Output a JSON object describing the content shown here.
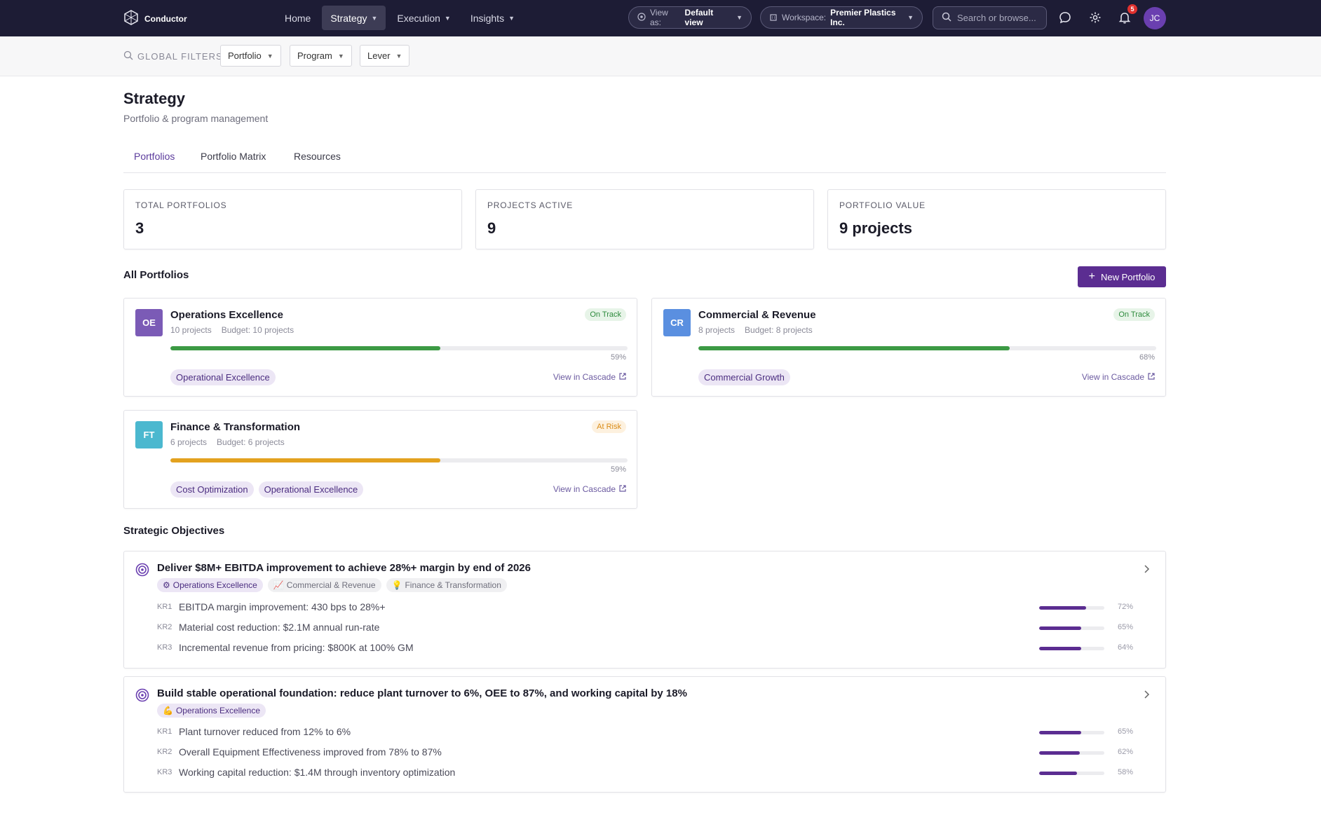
{
  "app": {
    "name": "Conductor"
  },
  "nav": {
    "items": [
      {
        "label": "Home"
      },
      {
        "label": "Strategy"
      },
      {
        "label": "Execution"
      },
      {
        "label": "Insights"
      }
    ],
    "view_as": {
      "label": "View as:",
      "value": "Default view"
    },
    "workspace": {
      "label": "Workspace:",
      "value": "Premier Plastics Inc."
    },
    "search_placeholder": "Search or browse...",
    "notifications_count": "5",
    "user_initials": "JC"
  },
  "filters": {
    "label": "GLOBAL FILTERS",
    "buttons": [
      {
        "label": "Portfolio"
      },
      {
        "label": "Program"
      },
      {
        "label": "Lever"
      }
    ]
  },
  "page": {
    "title": "Strategy",
    "subtitle": "Portfolio & program management",
    "tabs": [
      {
        "label": "Portfolios"
      },
      {
        "label": "Portfolio Matrix"
      },
      {
        "label": "Resources"
      }
    ]
  },
  "stats": [
    {
      "label": "TOTAL PORTFOLIOS",
      "value": "3"
    },
    {
      "label": "PROJECTS ACTIVE",
      "value": "9"
    },
    {
      "label": "PORTFOLIO VALUE",
      "value": "9 projects"
    }
  ],
  "portfolios_section": {
    "title": "All Portfolios",
    "new_button": "New Portfolio"
  },
  "portfolios": [
    {
      "initials": "OE",
      "color": "#7b5bb6",
      "name": "Operations Excellence",
      "projects": "10 projects",
      "budget": "Budget: 10 projects",
      "status": "On Track",
      "status_color": "#2e8b3d",
      "status_bg": "#e7f4e8",
      "progress": 59,
      "progress_label": "59%",
      "bar_color": "#3c9a44",
      "tags": [
        "Operational Excellence"
      ],
      "link": "View in Cascade"
    },
    {
      "initials": "CR",
      "color": "#5a8fe0",
      "name": "Commercial & Revenue",
      "projects": "8 projects",
      "budget": "Budget: 8 projects",
      "status": "On Track",
      "status_color": "#2e8b3d",
      "status_bg": "#e7f4e8",
      "progress": 68,
      "progress_label": "68%",
      "bar_color": "#3c9a44",
      "tags": [
        "Commercial Growth"
      ],
      "link": "View in Cascade"
    },
    {
      "initials": "FT",
      "color": "#4bb8cf",
      "name": "Finance & Transformation",
      "projects": "6 projects",
      "budget": "Budget: 6 projects",
      "status": "At Risk",
      "status_color": "#d98b16",
      "status_bg": "#fdf1df",
      "progress": 59,
      "progress_label": "59%",
      "bar_color": "#e3a21f",
      "tags": [
        "Cost Optimization",
        "Operational Excellence"
      ],
      "link": "View in Cascade"
    }
  ],
  "objectives_section": {
    "title": "Strategic Objectives"
  },
  "objectives": [
    {
      "title": "Deliver $8M+ EBITDA improvement to achieve 28%+ margin by end of 2026",
      "tags": [
        {
          "icon": "⚙",
          "label": "Operations Excellence"
        },
        {
          "icon": "📈",
          "label": "Commercial & Revenue"
        },
        {
          "icon": "💡",
          "label": "Finance & Transformation"
        }
      ],
      "krs": [
        {
          "id": "KR1",
          "text": "EBITDA margin improvement: 430 bps to 28%+",
          "progress": 72,
          "label": "72%"
        },
        {
          "id": "KR2",
          "text": "Material cost reduction: $2.1M annual run-rate",
          "progress": 65,
          "label": "65%"
        },
        {
          "id": "KR3",
          "text": "Incremental revenue from pricing: $800K at 100% GM",
          "progress": 64,
          "label": "64%"
        }
      ]
    },
    {
      "title": "Build stable operational foundation: reduce plant turnover to 6%, OEE to 87%, and working capital by 18%",
      "tags": [
        {
          "icon": "💪",
          "label": "Operations Excellence"
        }
      ],
      "krs": [
        {
          "id": "KR1",
          "text": "Plant turnover reduced from 12% to 6%",
          "progress": 65,
          "label": "65%"
        },
        {
          "id": "KR2",
          "text": "Overall Equipment Effectiveness improved from 78% to 87%",
          "progress": 62,
          "label": "62%"
        },
        {
          "id": "KR3",
          "text": "Working capital reduction: $1.4M through inventory optimization",
          "progress": 58,
          "label": "58%"
        }
      ]
    }
  ]
}
